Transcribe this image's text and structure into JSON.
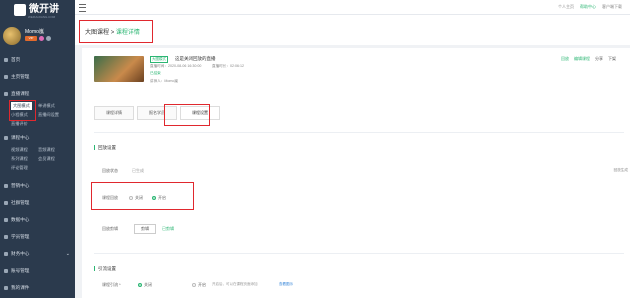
{
  "brand": {
    "name": "微开讲",
    "subtitle": "WEIKAIJIANG.COM"
  },
  "user": {
    "name": "Momo嵐",
    "vip_badge": "VIP"
  },
  "sidebar": {
    "items": [
      {
        "label": "首页"
      },
      {
        "label": "主页管理"
      },
      {
        "label": "直播课程"
      },
      {
        "label": "课程中心"
      },
      {
        "label": "营销中心"
      },
      {
        "label": "社群管理"
      },
      {
        "label": "数据中心"
      },
      {
        "label": "学员管理"
      },
      {
        "label": "财务中心"
      },
      {
        "label": "账号管理"
      },
      {
        "label": "我的课件"
      }
    ],
    "live_subitems": [
      "大图模式",
      "单讲模式",
      "小程模式",
      "直播间设置",
      "直播评价"
    ],
    "course_subitems": [
      "视频课程",
      "音频课程",
      "系列课程",
      "会员课程",
      "评论管理"
    ]
  },
  "topbar": {
    "links": [
      "个人主页",
      "帮助中心",
      "客户端下载"
    ]
  },
  "breadcrumb": {
    "part1": "大图课程",
    "sep": ">",
    "part2": "课程详情"
  },
  "course": {
    "tag": "大图模式",
    "title": "这是关闭回放的直播",
    "start_label": "直播时间：2020-08-06 16:30:00",
    "duration_label": "直播时长：02:06:12",
    "status": "已结束",
    "lecturer": "讲师人：Momo嵐",
    "actions": [
      "回放",
      "编辑课程",
      "分享",
      "下架"
    ]
  },
  "tabs": [
    "课程详情",
    "报名学员",
    "课程设置"
  ],
  "replay": {
    "section_title": "回放设置",
    "status_label": "回放状态",
    "status_value": "已生成",
    "side_link": "回放生成",
    "switch_label": "课程回放",
    "off": "关闭",
    "on": "开启",
    "edit_label": "回放剪辑",
    "edit_button": "剪辑",
    "edit_status": "已剪辑"
  },
  "guide": {
    "section_title": "引流设置",
    "label": "课程引流 *",
    "off": "关闭",
    "on": "开启",
    "hint": "开启后，可以在课程页面添加",
    "link": "查看图示"
  }
}
